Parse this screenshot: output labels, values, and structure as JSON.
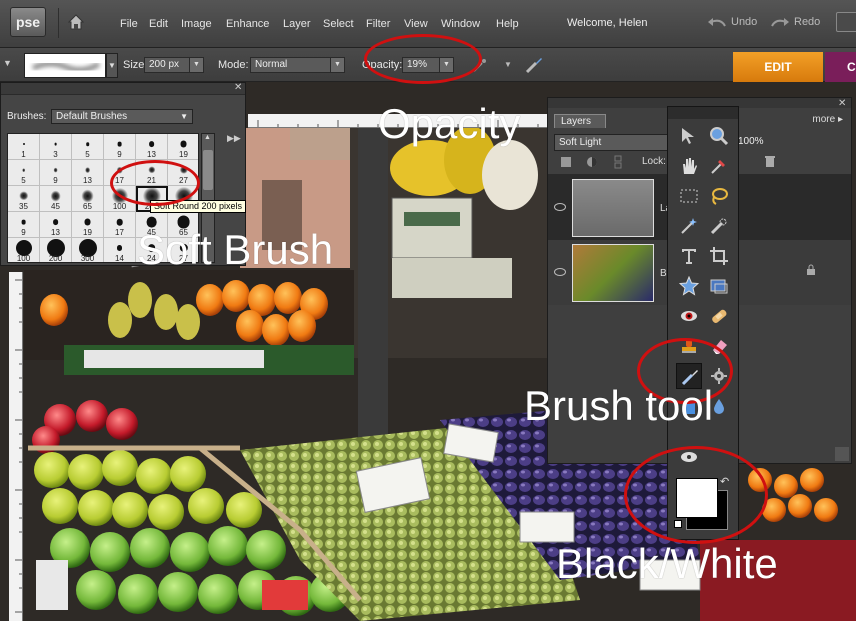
{
  "app": {
    "logo": "pse",
    "menu": [
      "File",
      "Edit",
      "Image",
      "Enhance",
      "Layer",
      "Select",
      "Filter",
      "View",
      "Window",
      "Help"
    ],
    "welcome": "Welcome, Helen",
    "undo_label": "Undo",
    "redo_label": "Redo"
  },
  "options_bar": {
    "size_label": "Size:",
    "size_value": "200 px",
    "mode_label": "Mode:",
    "mode_value": "Normal",
    "opacity_label": "Opacity:",
    "opacity_value": "19%",
    "edit_tab": "EDIT",
    "create_tab": "C"
  },
  "brushes_panel": {
    "label": "Brushes:",
    "preset": "Default Brushes",
    "grid": [
      "1",
      "3",
      "5",
      "9",
      "13",
      "19",
      "5",
      "9",
      "13",
      "17",
      "21",
      "27",
      "35",
      "45",
      "65",
      "100",
      "200",
      "300",
      "9",
      "13",
      "19",
      "17",
      "45",
      "65",
      "100",
      "200",
      "300",
      "14",
      "24",
      "27"
    ],
    "selected_index": 16,
    "tooltip": "Soft Round 200 pixels"
  },
  "layers_panel": {
    "tab": "Layers",
    "more": "more",
    "blend_mode": "Soft Light",
    "opacity": "100%",
    "lock_label": "Lock:",
    "layer1_name": "La",
    "layer2_name": "Ba"
  },
  "annotations": {
    "opacity": "Opacity",
    "soft_brush": "Soft Brush",
    "brush_tool": "Brush tool",
    "black_white": "Black/White"
  },
  "colors": {
    "accent_orange": "#f29a1e",
    "annotation_red": "#d01010",
    "foreground": "#ffffff",
    "background": "#000000"
  }
}
